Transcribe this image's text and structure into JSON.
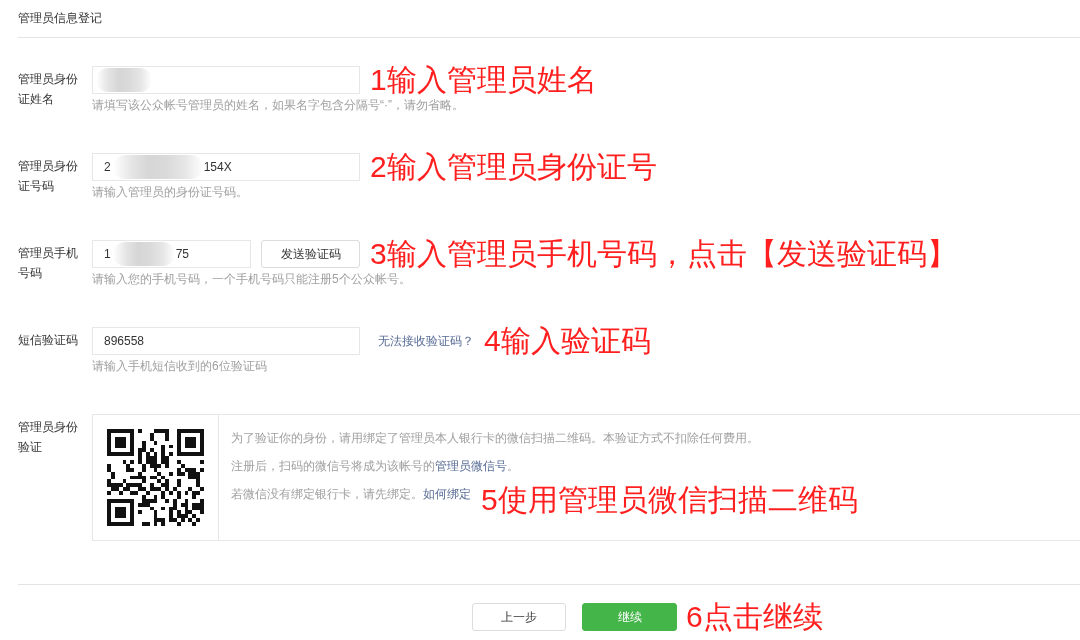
{
  "header": {
    "title": "管理员信息登记"
  },
  "fields": [
    {
      "kind": "input",
      "label": "管理员身份证姓名",
      "input": {
        "redacted": true
      },
      "hint": "请填写该公众帐号管理员的姓名，如果名字包含分隔号“·”，请勿省略。",
      "annotation": "1输入管理员姓名"
    },
    {
      "kind": "input",
      "label": "管理员身份证号码",
      "input": {
        "text_before": "2",
        "redacted": true,
        "text_after": "154X"
      },
      "hint": "请输入管理员的身份证号码。",
      "annotation": "2输入管理员身份证号"
    },
    {
      "kind": "input",
      "label": "管理员手机号码",
      "input": {
        "text_before": "1",
        "redacted": true,
        "text_after": "75"
      },
      "button": "发送验证码",
      "hint": "请输入您的手机号码，一个手机号码只能注册5个公众帐号。",
      "annotation": "3输入管理员手机号码，点击【发送验证码】"
    },
    {
      "kind": "input",
      "label": "短信验证码",
      "input": {
        "text_before": "896558",
        "redacted": false
      },
      "link": "无法接收验证码？",
      "hint": "请输入手机短信收到的6位验证码",
      "annotation": "4输入验证码"
    },
    {
      "kind": "qr_verify",
      "label": "管理员身份验证",
      "paragraphs": [
        {
          "parts": [
            {
              "kind": "plain",
              "text": "为了验证你的身份，请用绑定了管理员本人银行卡的微信扫描二维码。本验证方式不扣除任何费用。"
            }
          ]
        },
        {
          "parts": [
            {
              "kind": "plain",
              "text": "注册后，扫码的微信号将成为该帐号的"
            },
            {
              "kind": "link",
              "text": "管理员微信号"
            },
            {
              "kind": "plain",
              "text": "。"
            }
          ]
        },
        {
          "parts": [
            {
              "kind": "plain",
              "text": "若微信没有绑定银行卡，请先绑定。"
            },
            {
              "kind": "link",
              "text": "如何绑定"
            }
          ]
        }
      ],
      "annotation": "5使用管理员微信扫描二维码"
    }
  ],
  "footer": {
    "buttons": [
      {
        "kind": "secondary",
        "label": "上一步"
      },
      {
        "kind": "primary",
        "label": "继续"
      }
    ],
    "annotation": "6点击继续"
  }
}
